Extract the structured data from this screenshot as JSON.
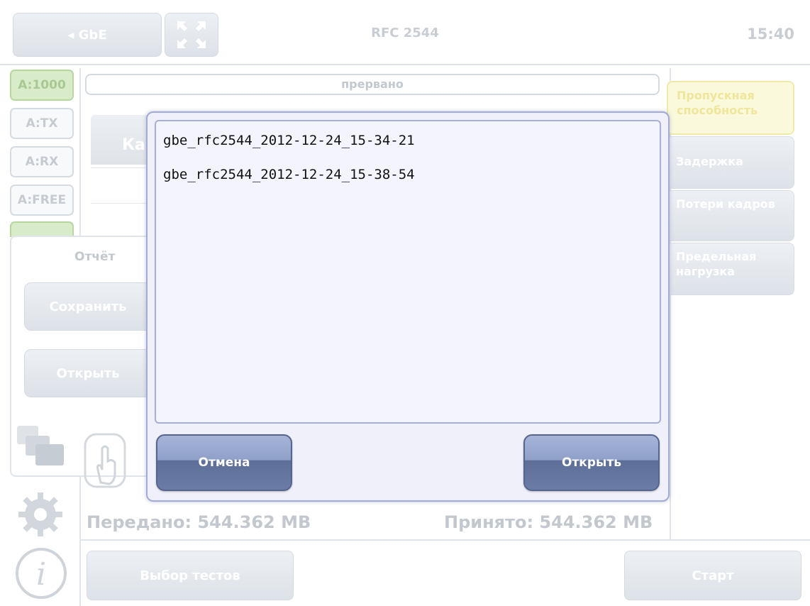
{
  "header": {
    "back_label": "◂ GbE",
    "title": "RFC 2544",
    "clock": "15:40"
  },
  "ports": [
    "A:1000",
    "A:TX",
    "A:RX",
    "A:FREE"
  ],
  "status": "прервано",
  "tabs": [
    {
      "label": "Пропускная способность"
    },
    {
      "label": "Задержка"
    },
    {
      "label": "Потери кадров"
    },
    {
      "label": "Предельная нагрузка"
    }
  ],
  "table": {
    "partial_header": "Ка"
  },
  "report": {
    "title": "Отчёт",
    "save_label": "Сохранить",
    "open_label": "Открыть"
  },
  "dialog": {
    "files": [
      "gbe_rfc2544_2012-12-24_15-34-21",
      "gbe_rfc2544_2012-12-24_15-38-54"
    ],
    "cancel_label": "Отмена",
    "open_label": "Открыть"
  },
  "stats": {
    "sent": "Передано: 544.362 MB",
    "received": "Принято: 544.362 MB"
  },
  "footer": {
    "tests_label": "Выбор тестов",
    "start_label": "Старт"
  },
  "colors": {
    "dialog_button": "#6b7ca6",
    "dialog_border": "#a3aad3",
    "active_tab": "#fbf9dc",
    "active_port": "#d9ecc9"
  }
}
